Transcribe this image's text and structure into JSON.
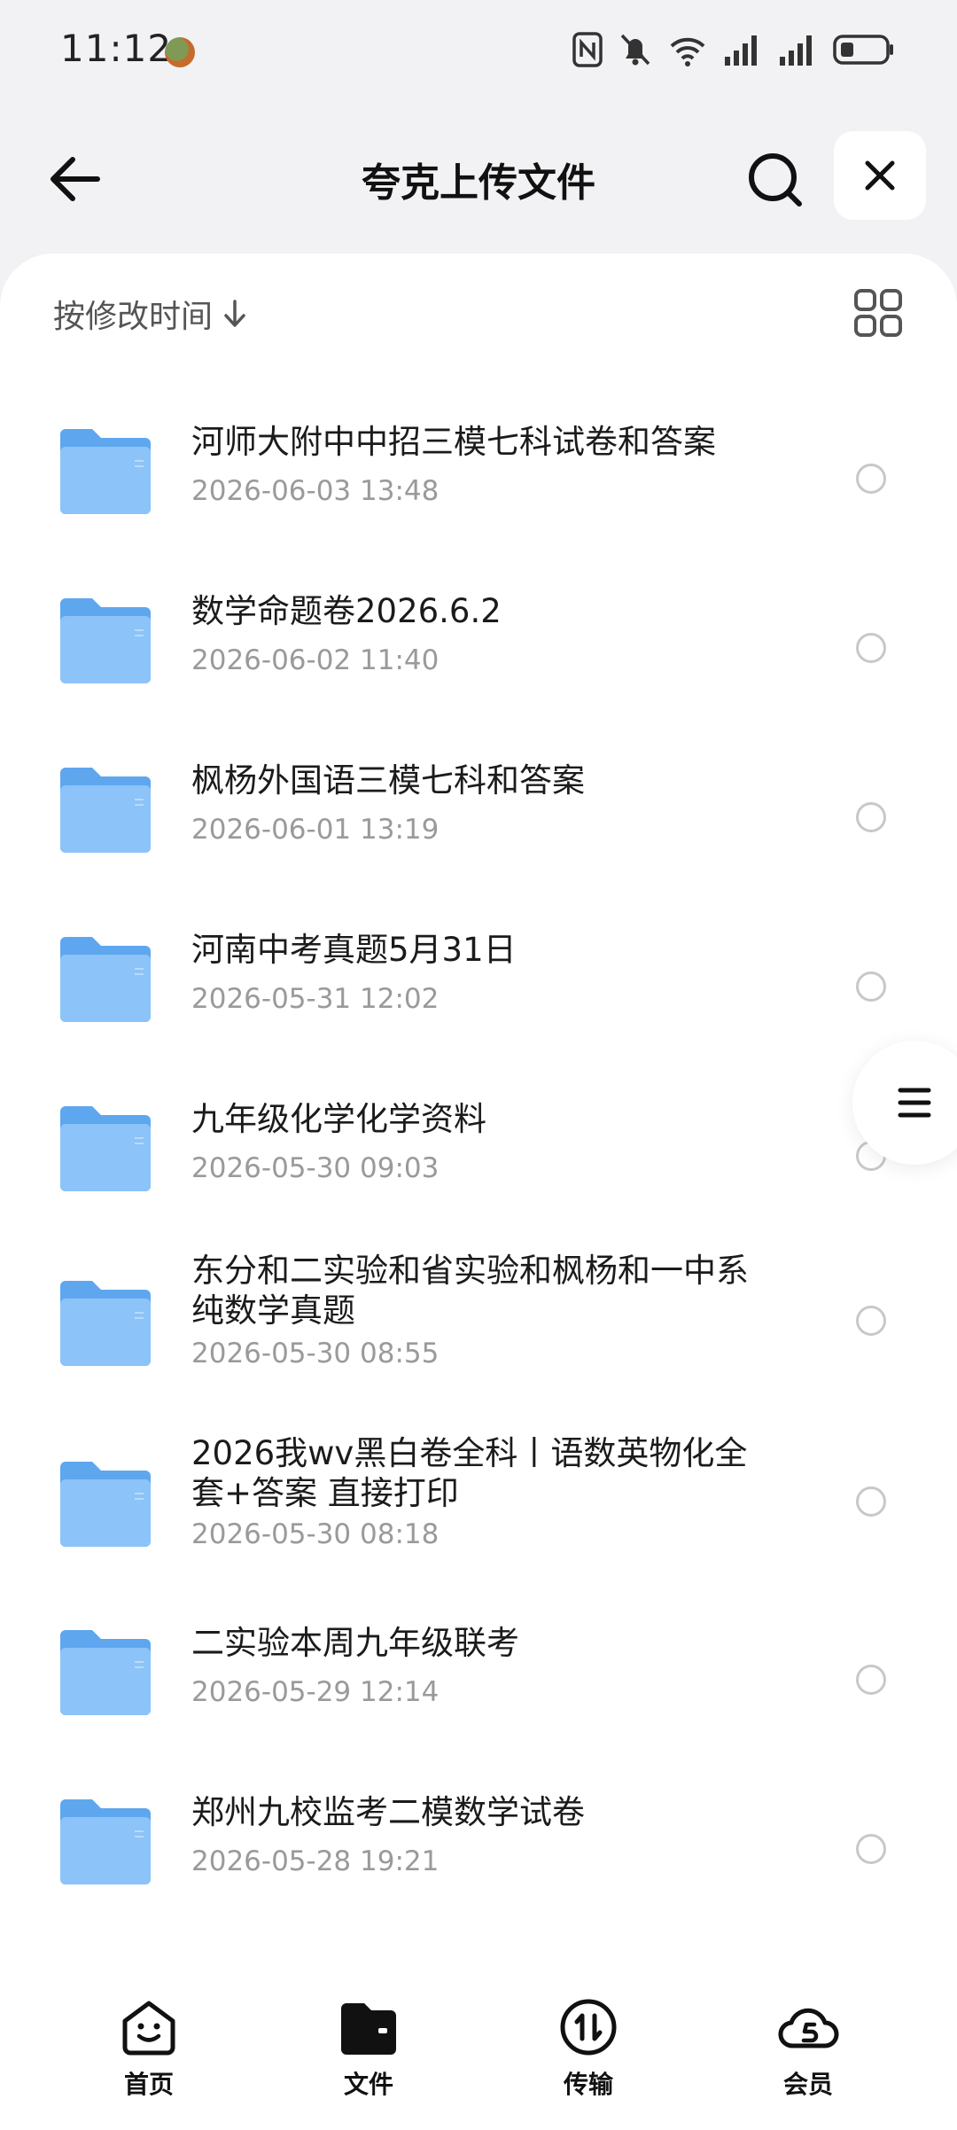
{
  "status_bar": {
    "time": "11:12"
  },
  "header": {
    "title": "夸克上传文件"
  },
  "sort": {
    "label": "按修改时间"
  },
  "files": [
    {
      "name": "河师大附中中招三模七科试卷和答案",
      "date": "2026-06-03 13:48"
    },
    {
      "name": "数学命题卷2026.6.2",
      "date": "2026-06-02 11:40"
    },
    {
      "name": "枫杨外国语三模七科和答案",
      "date": "2026-06-01 13:19"
    },
    {
      "name": "河南中考真题5月31日",
      "date": "2026-05-31 12:02"
    },
    {
      "name": "九年级化学化学资料",
      "date": "2026-05-30 09:03"
    },
    {
      "name": "东分和二实验和省实验和枫杨和一中系 纯数学真题",
      "date": "2026-05-30 08:55"
    },
    {
      "name": "2026我wv黑白卷全科丨语数英物化全套+答案 直接打印",
      "date": "2026-05-30 08:18"
    },
    {
      "name": "二实验本周九年级联考",
      "date": "2026-05-29 12:14"
    },
    {
      "name": "郑州九校监考二模数学试卷",
      "date": "2026-05-28 19:21"
    }
  ],
  "bottom_nav": {
    "home": "首页",
    "files": "文件",
    "transfer": "传输",
    "member": "会员"
  },
  "colors": {
    "folder": "#7fb8f5",
    "accent": "#111111"
  }
}
